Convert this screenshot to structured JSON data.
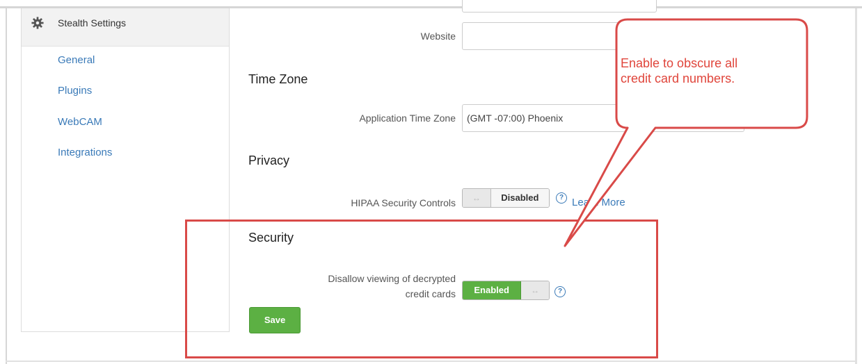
{
  "sidebar": {
    "title": "Stealth Settings",
    "items": [
      {
        "label": "General"
      },
      {
        "label": "Plugins"
      },
      {
        "label": "WebCAM"
      },
      {
        "label": "Integrations"
      }
    ]
  },
  "fields": {
    "website_label": "Website",
    "website_value": "",
    "timezone_label": "Application Time Zone",
    "timezone_value": "(GMT -07:00) Phoenix",
    "hipaa_label": "HIPAA Security Controls",
    "hipaa_state": "Disabled",
    "learn_more": "Learn More",
    "decrypt_label_line1": "Disallow viewing of decrypted",
    "decrypt_label_line2": "credit cards",
    "decrypt_state": "Enabled"
  },
  "sections": {
    "time_zone": "Time Zone",
    "privacy": "Privacy",
    "security": "Security"
  },
  "toggle_grip": "↔",
  "help_glyph": "?",
  "save_label": "Save",
  "annotation": {
    "callout_line1": "Enable to obscure all",
    "callout_line2": "credit card numbers."
  },
  "colors": {
    "accent_green": "#5cb043",
    "link_blue": "#3a7ab8",
    "annotation_red": "#d94a48"
  }
}
